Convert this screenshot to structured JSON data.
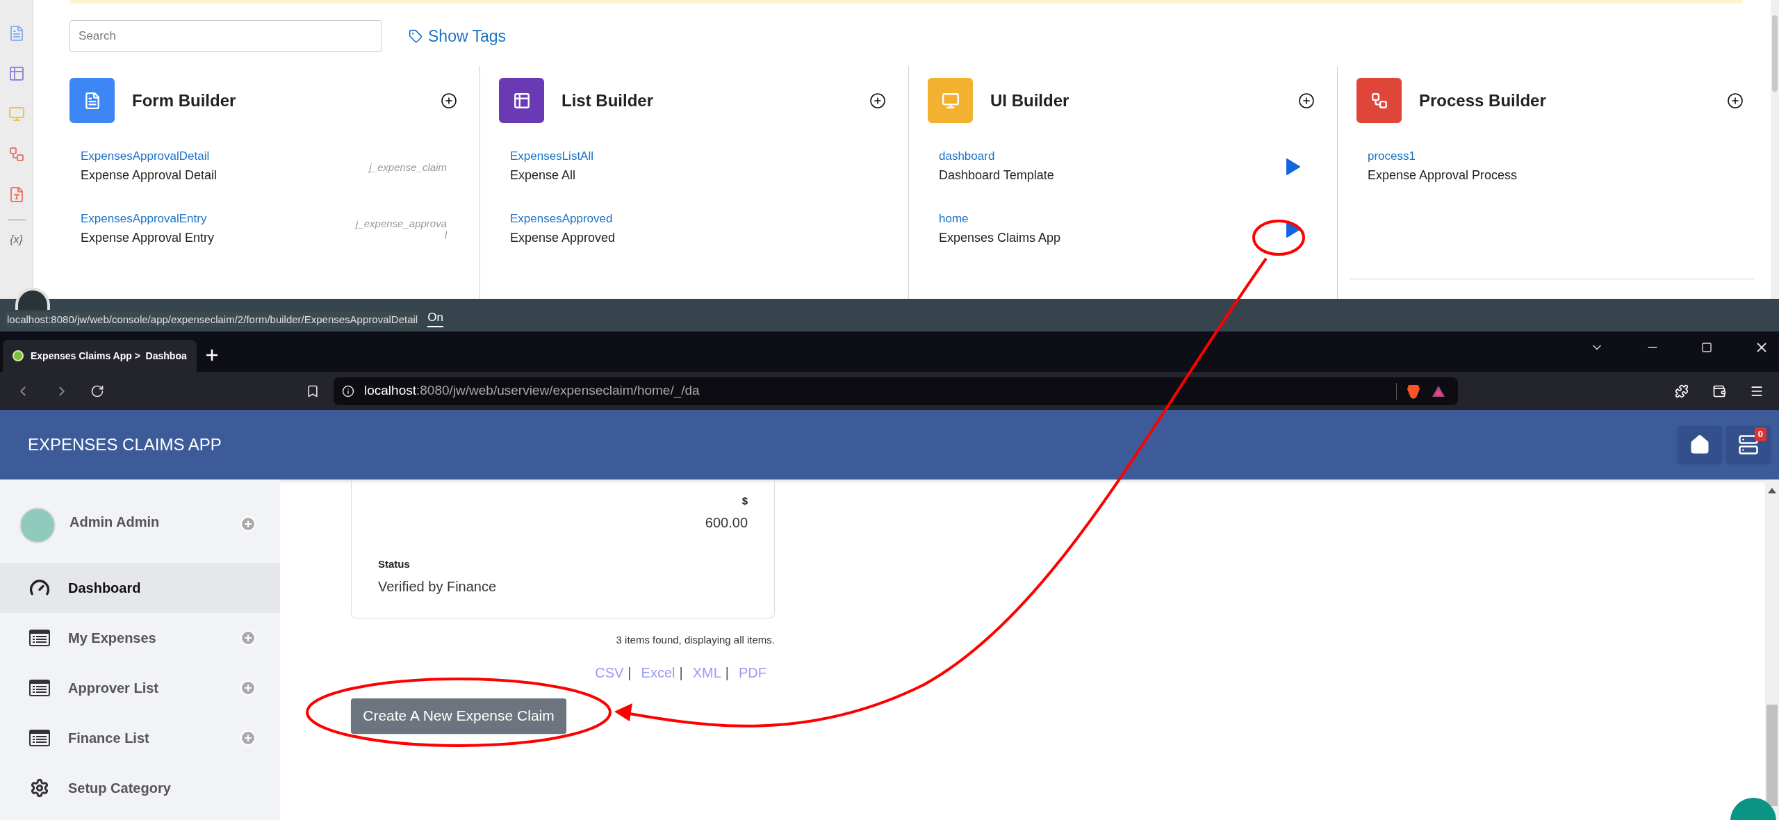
{
  "rail": {
    "variable_label": "{x}"
  },
  "search": {
    "placeholder": "Search"
  },
  "show_tags": "Show Tags",
  "builders": [
    {
      "kind": "form",
      "title": "Form Builder",
      "items": [
        {
          "link": "ExpensesApprovalDetail",
          "name": "Expense Approval Detail",
          "table": "j_expense_claim"
        },
        {
          "link": "ExpensesApprovalEntry",
          "name": "Expense Approval Entry",
          "table": "j_expense_approval"
        }
      ]
    },
    {
      "kind": "list",
      "title": "List Builder",
      "items": [
        {
          "link": "ExpensesListAll",
          "name": "Expense All"
        },
        {
          "link": "ExpensesApproved",
          "name": "Expense Approved"
        }
      ]
    },
    {
      "kind": "ui",
      "title": "UI Builder",
      "items": [
        {
          "link": "dashboard",
          "name": "Dashboard Template"
        },
        {
          "link": "home",
          "name": "Expenses Claims App"
        }
      ]
    },
    {
      "kind": "process",
      "title": "Process Builder",
      "items": [
        {
          "link": "process1",
          "name": "Expense Approval Process"
        }
      ]
    }
  ],
  "status_bar": {
    "url": "localhost:8080/jw/web/console/app/expenseclaim/2/form/builder/ExpensesApprovalDetail",
    "toggle": "On"
  },
  "browser": {
    "tabs": [
      {
        "title": "Expenses Claims App >  Dashboa",
        "selected": true
      }
    ],
    "address": {
      "host": "localhost",
      "path": ":8080/jw/web/userview/expenseclaim/home/_/da"
    }
  },
  "app": {
    "title": "EXPENSES CLAIMS APP",
    "notification_count": "0"
  },
  "user": {
    "name": "Admin Admin"
  },
  "menu": [
    {
      "kind": "dashboard",
      "label": "Dashboard",
      "selected": true,
      "expandable": false
    },
    {
      "kind": "list",
      "label": "My Expenses",
      "selected": false,
      "expandable": true
    },
    {
      "kind": "list",
      "label": "Approver List",
      "selected": false,
      "expandable": true
    },
    {
      "kind": "list",
      "label": "Finance List",
      "selected": false,
      "expandable": true
    },
    {
      "kind": "settings",
      "label": "Setup Category",
      "selected": false,
      "expandable": false
    }
  ],
  "card": {
    "amount_label": "$",
    "amount": "600.00",
    "status_label": "Status",
    "status": "Verified by Finance"
  },
  "items_found": "3 items found, displaying all items.",
  "export_links": [
    {
      "label": "CSV",
      "separator": "|"
    },
    {
      "label": "Excel",
      "separator": "|"
    },
    {
      "label": "XML",
      "separator": "|"
    },
    {
      "label": "PDF"
    }
  ],
  "new_claim_button": "Create A New Expense Claim"
}
